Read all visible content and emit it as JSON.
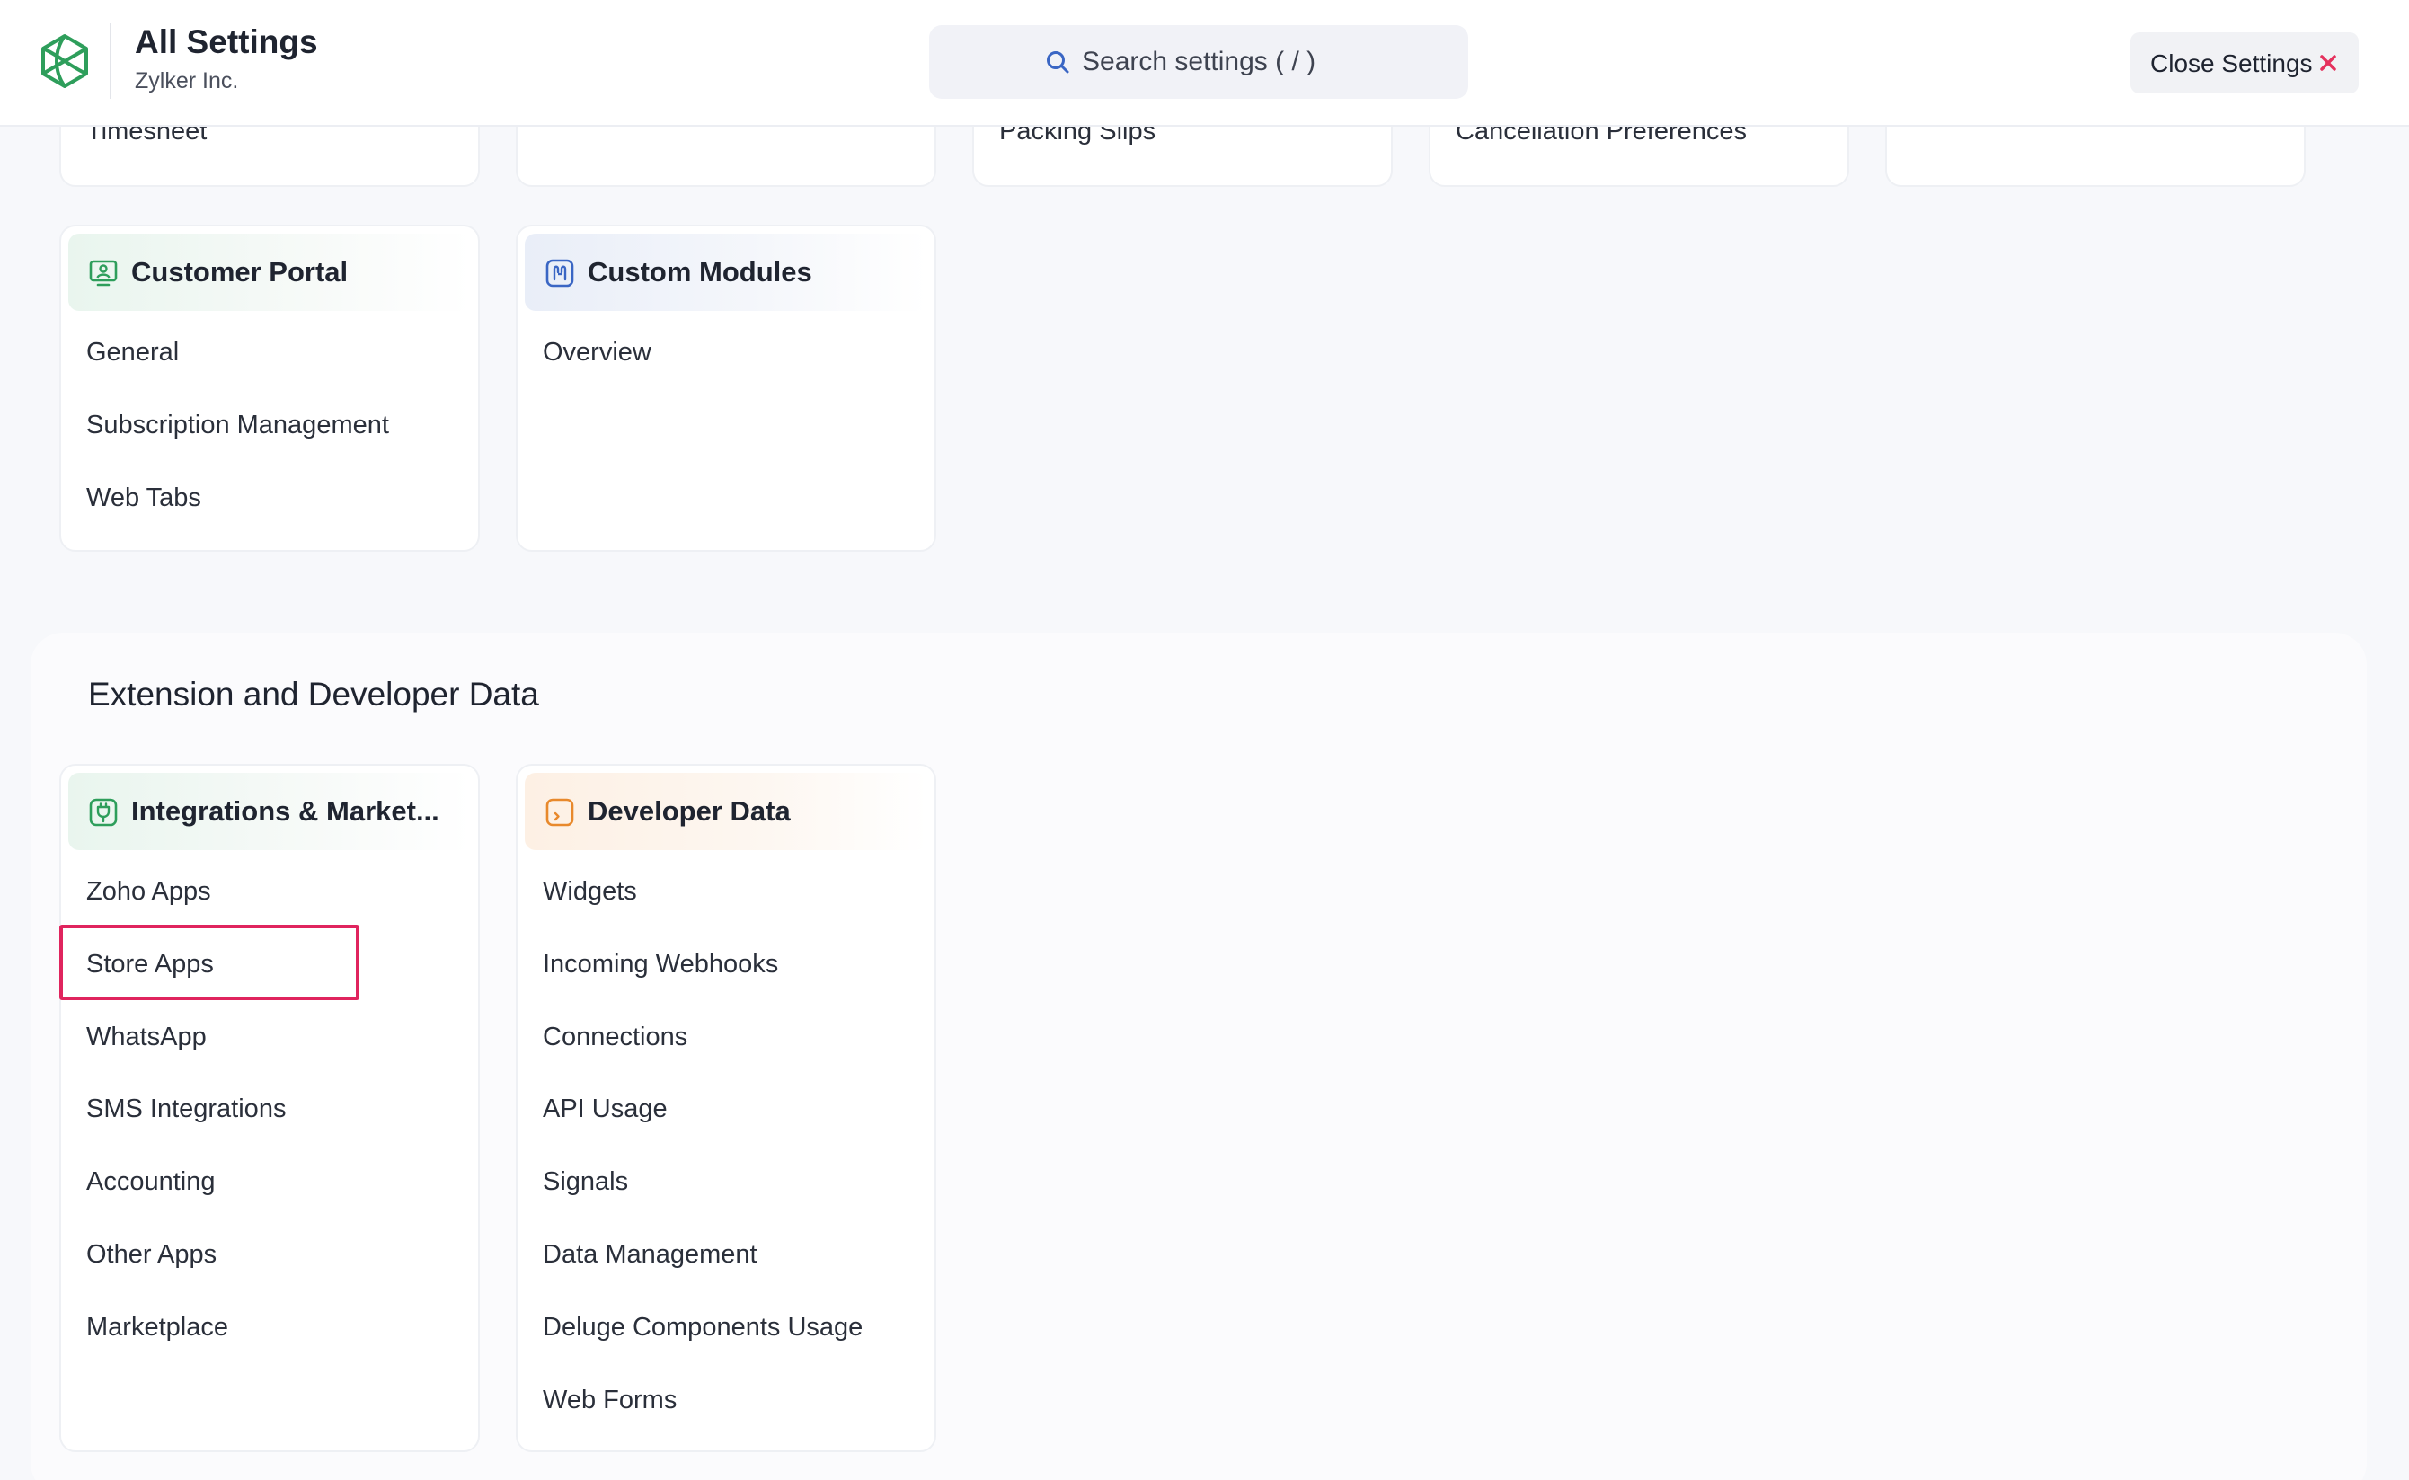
{
  "header": {
    "title": "All Settings",
    "org_name": "Zylker Inc.",
    "search_placeholder": "Search settings ( / )",
    "close_label": "Close Settings"
  },
  "top_stub_cards": [
    {
      "label": "Timesheet"
    },
    {
      "label": ""
    },
    {
      "label": "Packing Slips"
    },
    {
      "label": "Cancellation Preferences"
    },
    {
      "label": ""
    }
  ],
  "customer_portal": {
    "title": "Customer Portal",
    "icon": "monitor-user-icon",
    "items": [
      "General",
      "Subscription Management",
      "Web Tabs"
    ]
  },
  "custom_modules": {
    "title": "Custom Modules",
    "icon": "custom-module-icon",
    "items": [
      "Overview"
    ]
  },
  "extension_section": {
    "title": "Extension and Developer Data"
  },
  "integrations": {
    "title": "Integrations & Market...",
    "icon": "plug-icon",
    "items": [
      "Zoho Apps",
      "Store Apps",
      "WhatsApp",
      "SMS Integrations",
      "Accounting",
      "Other Apps",
      "Marketplace"
    ],
    "highlighted_item": "Store Apps"
  },
  "developer_data": {
    "title": "Developer Data",
    "icon": "terminal-icon",
    "items": [
      "Widgets",
      "Incoming Webhooks",
      "Connections",
      "API Usage",
      "Signals",
      "Data Management",
      "Deluge Components Usage",
      "Web Forms"
    ]
  },
  "colors": {
    "brand_green": "#2e9e5b",
    "accent_blue": "#3a66c4",
    "accent_orange": "#e8892c",
    "highlight": "#e0245e",
    "close_icon": "#e5315d"
  }
}
